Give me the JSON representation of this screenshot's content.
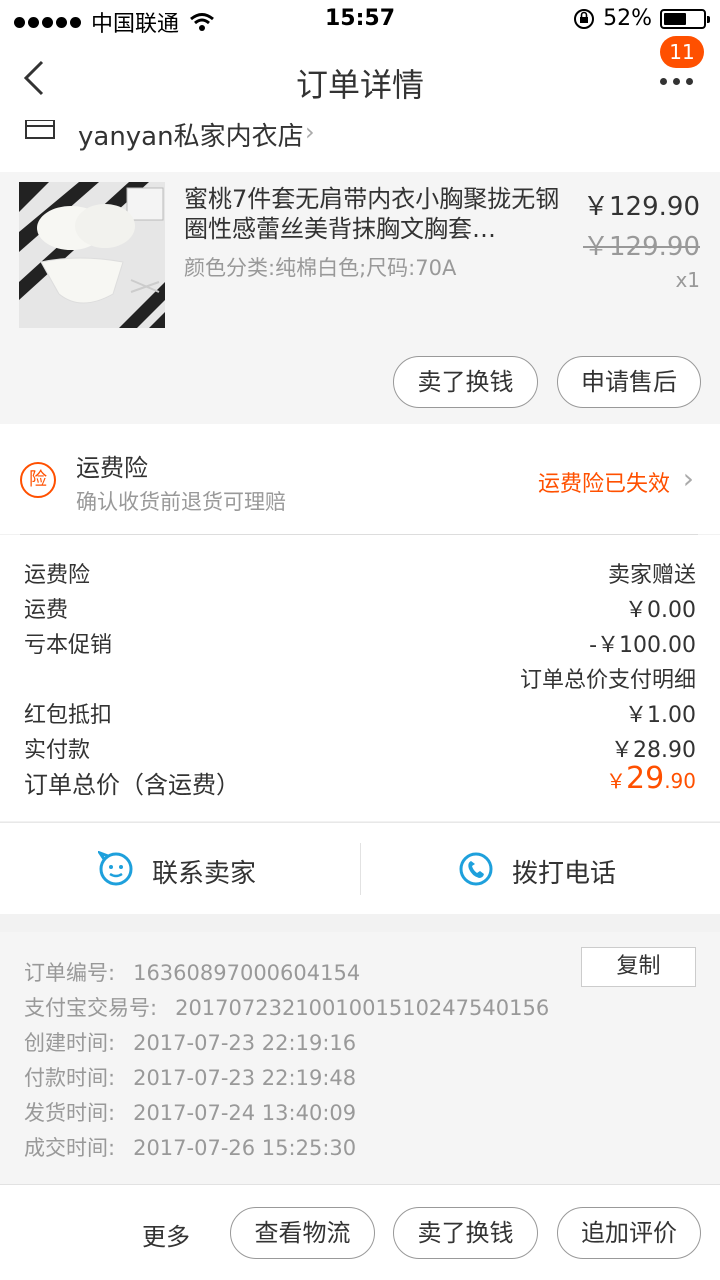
{
  "status_bar": {
    "carrier": "中国联通",
    "time": "15:57",
    "battery_percent": "52%",
    "battery_level": 0.52
  },
  "nav": {
    "title": "订单详情",
    "badge_count": "11"
  },
  "store": {
    "name": "yanyan私家内衣店"
  },
  "product": {
    "name": "蜜桃7件套无肩带内衣小胸聚拢无钢圈性感蕾丝美背抹胸文胸套…",
    "sku": "颜色分类:纯棉白色;尺码:70A",
    "price": "￥129.90",
    "original_price": "￥129.90",
    "quantity": "x1",
    "buttons": {
      "exchange": "卖了换钱",
      "after_sale": "申请售后"
    }
  },
  "insurance": {
    "icon_text": "险",
    "title": "运费险",
    "subtitle": "确认收货前退货可理赔",
    "status": "运费险已失效"
  },
  "fees": {
    "freight_insurance": {
      "label": "运费险",
      "value": "卖家赠送"
    },
    "shipping": {
      "label": "运费",
      "value": "￥0.00"
    },
    "promotion": {
      "label": "亏本促销",
      "value": "-￥100.00"
    },
    "payment_detail_link": "订单总价支付明细",
    "red_packet": {
      "label": "红包抵扣",
      "value": "￥1.00"
    },
    "actual_paid": {
      "label": "实付款",
      "value": "￥28.90"
    },
    "total": {
      "label": "订单总价（含运费）",
      "currency": "￥",
      "integer": "29",
      "decimal": ".90"
    }
  },
  "contact": {
    "seller": "联系卖家",
    "phone": "拨打电话"
  },
  "order_info": {
    "copy_button": "复制",
    "rows": [
      {
        "key": "订单编号:",
        "value": "16360897000604154"
      },
      {
        "key": "支付宝交易号:",
        "value": "2017072321001001510247540156"
      },
      {
        "key": "创建时间:",
        "value": "2017-07-23 22:19:16"
      },
      {
        "key": "付款时间:",
        "value": "2017-07-23 22:19:48"
      },
      {
        "key": "发货时间:",
        "value": "2017-07-24 13:40:09"
      },
      {
        "key": "成交时间:",
        "value": "2017-07-26 15:25:30"
      }
    ]
  },
  "bottom_bar": {
    "more": "更多",
    "logistics": "查看物流",
    "exchange": "卖了换钱",
    "review": "追加评价"
  },
  "colors": {
    "accent": "#ff5000",
    "contact_icon": "#1ea0dc"
  }
}
